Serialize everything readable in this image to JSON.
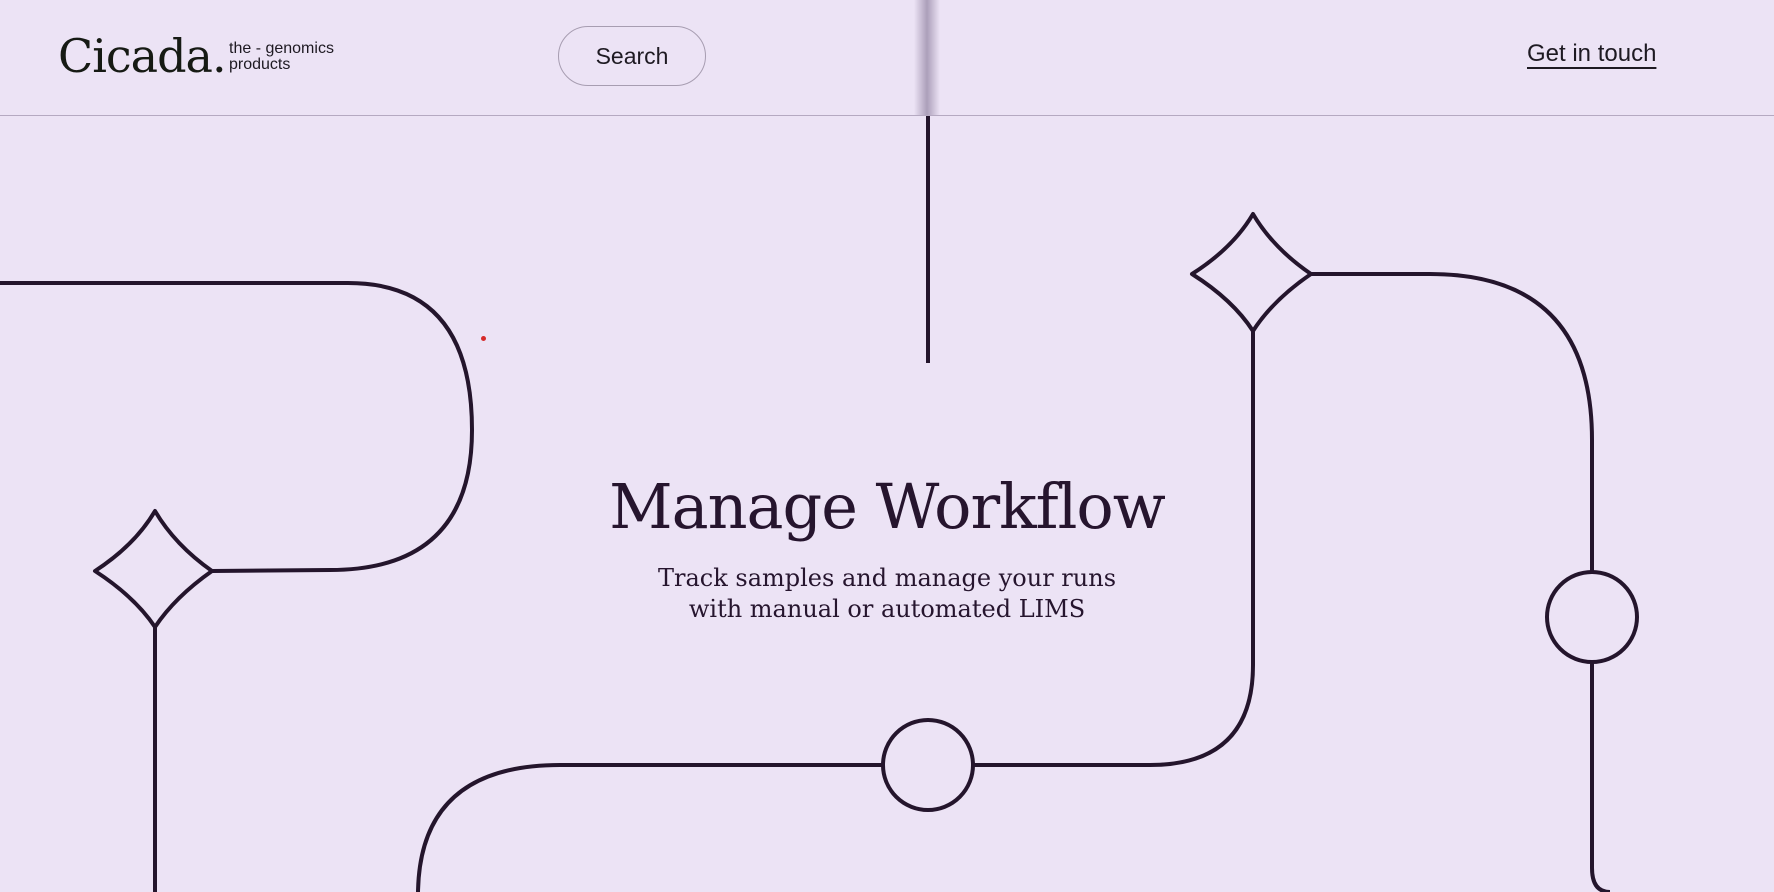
{
  "header": {
    "logo": "Cicada.",
    "tagline_line1": "the - genomics",
    "tagline_line2": "products",
    "search_label": "Search",
    "contact_label": "Get in touch"
  },
  "hero": {
    "title": "Manage Workflow",
    "subtitle_line1": "Track samples and manage your runs",
    "subtitle_line2": "with manual or automated LIMS"
  },
  "colors": {
    "background": "#ece3f5",
    "line": "#24152c",
    "text": "#26152e",
    "cursor_dot": "#d62a2a"
  }
}
